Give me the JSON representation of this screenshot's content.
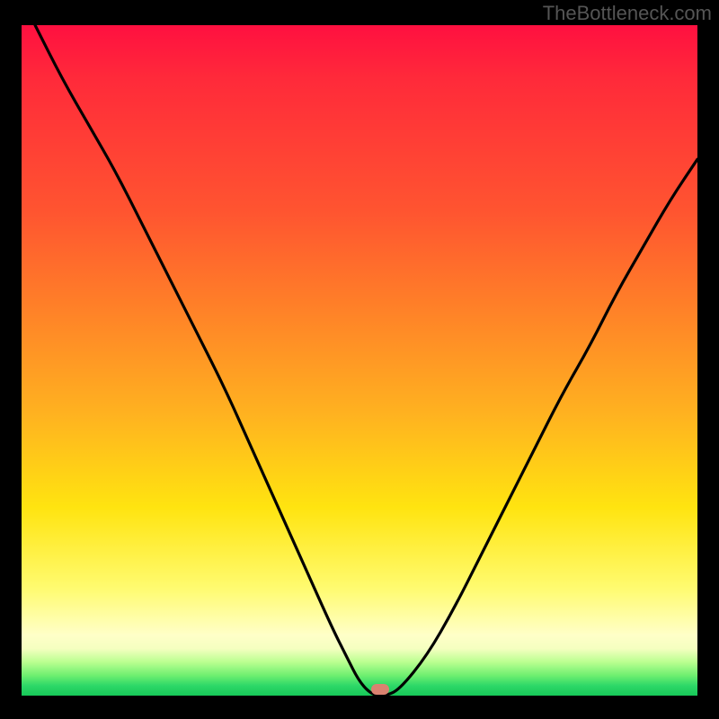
{
  "attribution": "TheBottleneck.com",
  "marker": {
    "x_pct": 53,
    "y_pct": 99.1,
    "color": "#da8270"
  },
  "chart_data": {
    "type": "line",
    "title": "",
    "xlabel": "",
    "ylabel": "",
    "xlim": [
      0,
      100
    ],
    "ylim": [
      0,
      100
    ],
    "gradient_colors": [
      "#ff1040",
      "#ff8028",
      "#ffe410",
      "#ffffc8",
      "#16c858"
    ],
    "series": [
      {
        "name": "bottleneck-curve",
        "x": [
          2,
          6,
          10,
          14,
          18,
          22,
          26,
          30,
          34,
          38,
          42,
          46,
          48,
          50,
          52,
          54,
          56,
          60,
          64,
          68,
          72,
          76,
          80,
          84,
          88,
          92,
          96,
          100
        ],
        "y": [
          100,
          92,
          85,
          78,
          70,
          62,
          54,
          46,
          37,
          28,
          19,
          10,
          6,
          2,
          0,
          0,
          1,
          6,
          13,
          21,
          29,
          37,
          45,
          52,
          60,
          67,
          74,
          80
        ]
      }
    ],
    "flat_bottom_x_range": [
      50,
      55
    ],
    "marker_point": {
      "x": 53,
      "y": 0
    }
  }
}
